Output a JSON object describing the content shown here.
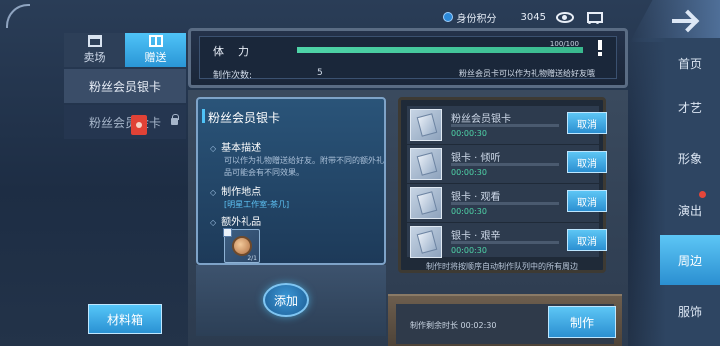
{
  "topbar": {
    "currency_label": "身份积分",
    "currency_value": "3045",
    "currency_icon": "gem-icon",
    "eye_icon": "eye-icon",
    "cart_icon": "cart-icon"
  },
  "left_panel": {
    "tabs": [
      {
        "label": "卖场",
        "icon": "shop-icon"
      },
      {
        "label": "赠送",
        "icon": "gift-icon",
        "active": true
      }
    ],
    "categories": [
      {
        "label": "粉丝会员银卡",
        "selected": true
      },
      {
        "label": "粉丝会员金卡",
        "locked": true
      }
    ],
    "material_button": "材料箱"
  },
  "status": {
    "stamina_label": "体力",
    "stamina_value": "100/100",
    "stamina_fraction": 1.0,
    "craft_count_label": "制作次数:",
    "craft_count": "5",
    "gift_note": "粉丝会员卡可以作为礼物赠送给好友哦"
  },
  "info_card": {
    "title": "粉丝会员银卡",
    "basic_desc_title": "基本描述",
    "basic_desc_text": "可以作为礼物赠送给好友。附带不同的额外礼品可能会有不同效果。",
    "place_title": "制作地点",
    "place_value": "[明星工作室-茶几]",
    "extra_title": "额外礼品",
    "reward_count": "2/1"
  },
  "add_button": "添加",
  "queue": {
    "items": [
      {
        "name": "粉丝会员银卡",
        "time": "00:00:30",
        "progress": 0.0,
        "cancel": "取消"
      },
      {
        "name": "银卡 · 倾听",
        "time": "00:00:30",
        "progress": 0.0,
        "cancel": "取消"
      },
      {
        "name": "银卡 · 观看",
        "time": "00:00:30",
        "progress": 0.0,
        "cancel": "取消"
      },
      {
        "name": "银卡 · 艰辛",
        "time": "00:00:30",
        "progress": 0.0,
        "cancel": "取消"
      }
    ],
    "note": "制作时将按顺序自动制作队列中的所有周边"
  },
  "craft": {
    "remain_label": "制作剩余时长",
    "remain_time": "00:02:30",
    "button": "制作"
  },
  "right_nav": [
    {
      "label": "首页"
    },
    {
      "label": "才艺"
    },
    {
      "label": "形象"
    },
    {
      "label": "演出",
      "dot": true
    },
    {
      "label": "周边",
      "active": true
    },
    {
      "label": "服饰"
    }
  ],
  "colors": {
    "accent": "#4fc3f7",
    "timer_green": "#4fd4a8",
    "dot_red": "#e5463a"
  }
}
